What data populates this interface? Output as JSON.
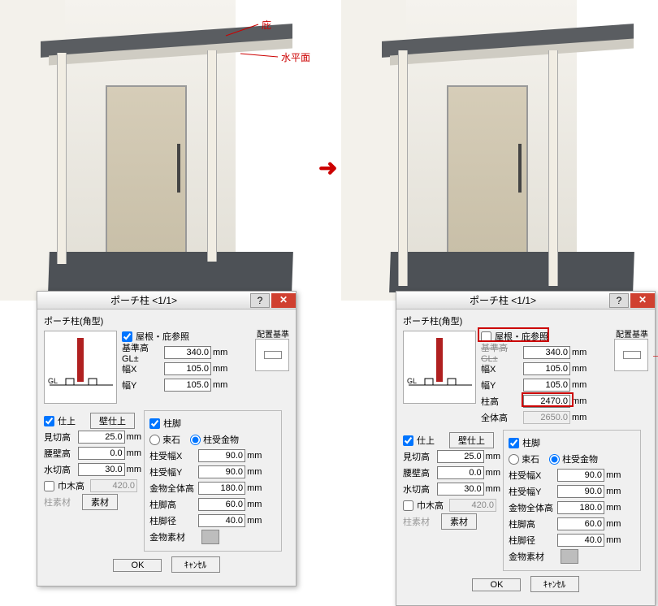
{
  "annotations": {
    "eave": "庇",
    "plane": "水平面"
  },
  "dialog": {
    "title": "ポーチ柱  <1/1>",
    "subtitle": "ポーチ柱(角型)",
    "roof_ref": "屋根・庇参照",
    "base_h_label": "基準高 GL±",
    "base_h": "340.0",
    "base_h_alt_label": "基準高 GL±",
    "width_x_label": "幅X",
    "width_x": "105.0",
    "width_y_label": "幅Y",
    "width_y": "105.0",
    "col_h_label": "柱高",
    "col_h": "2470.0",
    "total_h_label": "全体高",
    "total_h": "2650.0",
    "align_label": "配置基準",
    "finish_chk": "仕上",
    "wall_finish_btn": "壁仕上",
    "reveal_label": "見切高",
    "reveal": "25.0",
    "skirt_label": "腰壁高",
    "skirt": "0.0",
    "drip_label": "水切高",
    "drip": "30.0",
    "base_label": "巾木高",
    "base": "420.0",
    "col_mat_label": "柱素材",
    "mat_btn": "素材",
    "foot_chk": "柱脚",
    "foot_stone": "束石",
    "foot_metal": "柱受金物",
    "rx_label": "柱受幅X",
    "rx": "90.0",
    "ry_label": "柱受幅Y",
    "ry": "90.0",
    "mh_label": "金物全体高",
    "mh": "180.0",
    "fh_label": "柱脚高",
    "fh": "60.0",
    "fd_label": "柱脚径",
    "fd": "40.0",
    "mm_label": "金物素材",
    "unit": "mm",
    "ok": "OK",
    "cancel": "ｷｬﾝｾﾙ",
    "gl": "GL"
  }
}
